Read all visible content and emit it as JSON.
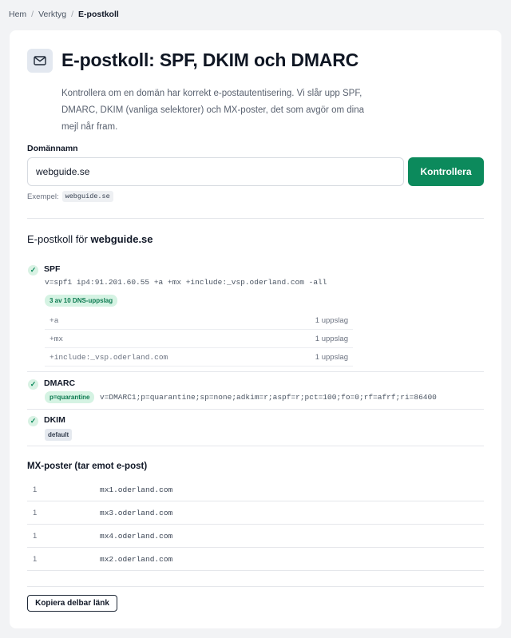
{
  "breadcrumb": {
    "home": "Hem",
    "tools": "Verktyg",
    "current": "E-postkoll",
    "separator": "/"
  },
  "header": {
    "icon": "mail-icon",
    "title": "E-postkoll: SPF, DKIM och DMARC",
    "intro": "Kontrollera om en domän har korrekt e-postautentisering. Vi slår upp SPF, DMARC, DKIM (vanliga selektorer) och MX-poster, det som avgör om dina mejl når fram."
  },
  "form": {
    "label": "Domännamn",
    "value": "webguide.se",
    "button": "Kontrollera",
    "example_label": "Exempel:",
    "example_value": "webguide.se"
  },
  "result": {
    "title_prefix": "E-postkoll för",
    "domain": "webguide.se",
    "spf": {
      "label": "SPF",
      "record": "v=spf1 ip4:91.201.60.55 +a +mx +include:_vsp.oderland.com -all",
      "badge": "3 av 10 DNS-uppslag",
      "lookups": [
        {
          "mechanism": "+a",
          "count": "1 uppslag"
        },
        {
          "mechanism": "+mx",
          "count": "1 uppslag"
        },
        {
          "mechanism": "+include:_vsp.oderland.com",
          "count": "1 uppslag"
        }
      ]
    },
    "dmarc": {
      "label": "DMARC",
      "policy_badge": "p=quarantine",
      "record": "v=DMARC1;p=quarantine;sp=none;adkim=r;aspf=r;pct=100;fo=0;rf=afrf;ri=86400"
    },
    "dkim": {
      "label": "DKIM",
      "selector": "default"
    },
    "mx": {
      "title": "MX-poster (tar emot e-post)",
      "records": [
        {
          "priority": "1",
          "host": "mx1.oderland.com"
        },
        {
          "priority": "1",
          "host": "mx3.oderland.com"
        },
        {
          "priority": "1",
          "host": "mx4.oderland.com"
        },
        {
          "priority": "1",
          "host": "mx2.oderland.com"
        }
      ]
    },
    "share_button": "Kopiera delbar länk"
  },
  "colors": {
    "accent": "#0c8a5c",
    "success_bg": "#d5f3e3",
    "page_bg": "#f2f3f5"
  }
}
